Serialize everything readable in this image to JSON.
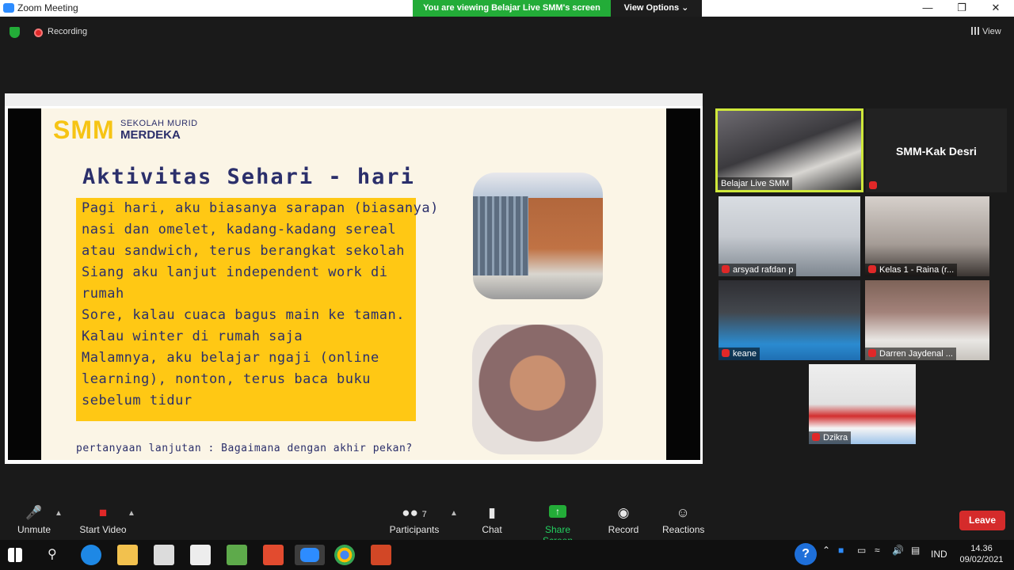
{
  "window": {
    "title": "Zoom Meeting",
    "viewing_banner": "You are viewing Belajar Live SMM's screen",
    "view_options": "View Options ⌄",
    "minimize": "—",
    "restore": "❐",
    "close": "✕"
  },
  "topbar": {
    "recording_label": "Recording",
    "view_label": "View"
  },
  "slide": {
    "logo_text": "SMM",
    "logo_line1": "SEKOLAH MURID",
    "logo_line2": "MERDEKA",
    "title": "Aktivitas Sehari - hari",
    "lines": [
      "Pagi hari, aku biasanya sarapan (biasanya)",
      "nasi dan omelet, kadang-kadang sereal",
      "atau sandwich, terus berangkat sekolah",
      "Siang aku lanjut independent work di",
      "rumah",
      "Sore, kalau cuaca bagus main ke taman.",
      "Kalau winter di rumah saja",
      "Malamnya, aku belajar ngaji (online",
      "learning), nonton, terus baca buku",
      "sebelum tidur"
    ],
    "footer": "pertanyaan lanjutan : Bagaimana dengan akhir pekan?"
  },
  "participants_gallery": {
    "host": "Belajar Live SMM",
    "desri": "SMM-Kak Desri",
    "arsyad": "arsyad rafdan p",
    "raina": "Kelas 1 - Raina (r...",
    "keane": "keane",
    "darren": "Darren Jaydenal ...",
    "dzikra": "Dzikra"
  },
  "toolbar": {
    "unmute": "Unmute",
    "start_video": "Start Video",
    "participants_count": "7",
    "participants": "Participants",
    "chat": "Chat",
    "share_screen": "Share Screen",
    "record": "Record",
    "reactions": "Reactions",
    "leave": "Leave"
  },
  "taskbar": {
    "language": "IND",
    "time": "14.36",
    "date": "09/02/2021"
  },
  "colors": {
    "accent_green": "#23ac38",
    "slide_yellow": "#ffc814",
    "slide_navy": "#2b2f6b",
    "leave_red": "#d52b2b"
  }
}
